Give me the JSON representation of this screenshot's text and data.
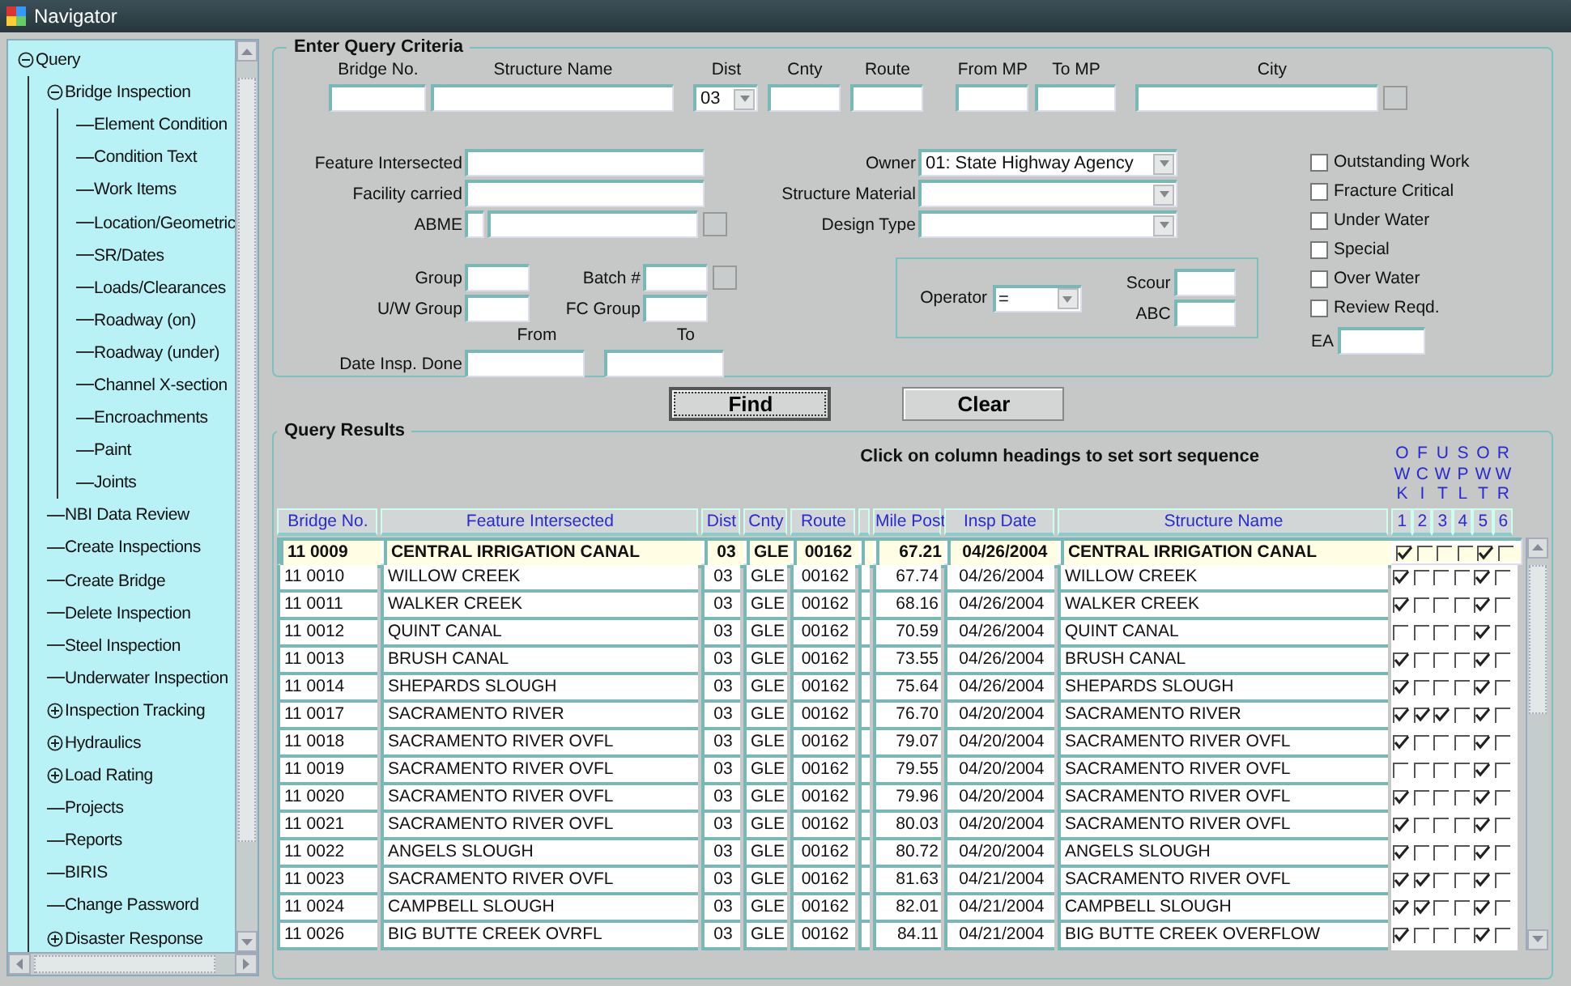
{
  "nav": {
    "title": "Navigator",
    "tree": [
      {
        "label": "Query",
        "expanded": true,
        "children": [
          {
            "label": "Bridge Inspection",
            "expanded": true,
            "children": [
              {
                "label": "Element Condition"
              },
              {
                "label": "Condition Text"
              },
              {
                "label": "Work Items"
              },
              {
                "label": "Location/Geometric"
              },
              {
                "label": "SR/Dates"
              },
              {
                "label": "Loads/Clearances"
              },
              {
                "label": "Roadway (on)"
              },
              {
                "label": "Roadway (under)"
              },
              {
                "label": "Channel X-section"
              },
              {
                "label": "Encroachments"
              },
              {
                "label": "Paint"
              },
              {
                "label": "Joints"
              }
            ]
          },
          {
            "label": "NBI Data Review"
          },
          {
            "label": "Create Inspections"
          },
          {
            "label": "Create Bridge"
          },
          {
            "label": "Delete Inspection"
          },
          {
            "label": "Steel Inspection"
          },
          {
            "label": "Underwater Inspection"
          },
          {
            "label": "Inspection Tracking",
            "expanded": false
          },
          {
            "label": "Hydraulics",
            "expanded": false
          },
          {
            "label": "Load Rating",
            "expanded": false
          },
          {
            "label": "Projects"
          },
          {
            "label": "Reports"
          },
          {
            "label": "BIRIS"
          },
          {
            "label": "Change Password"
          },
          {
            "label": "Disaster Response",
            "expanded": false
          }
        ]
      }
    ]
  },
  "criteria": {
    "title": "Enter Query Criteria",
    "top_fields": [
      {
        "label": "Bridge No.",
        "kind": "text"
      },
      {
        "label": "Structure Name",
        "kind": "text"
      },
      {
        "label": "Dist",
        "kind": "select",
        "value": "03"
      },
      {
        "label": "Cnty",
        "kind": "text"
      },
      {
        "label": "Route",
        "kind": "text"
      },
      {
        "label": "From MP",
        "kind": "text"
      },
      {
        "label": "To MP",
        "kind": "text"
      },
      {
        "label": "City",
        "kind": "lookup"
      }
    ],
    "left_fields": [
      {
        "label": "Feature Intersected",
        "kind": "text"
      },
      {
        "label": "Facility carried",
        "kind": "text"
      },
      {
        "label": "ABME",
        "kind": "code-lookup"
      }
    ],
    "group_fields": [
      {
        "label": "Group",
        "kind": "text"
      },
      {
        "label": "Batch #",
        "kind": "lookup"
      },
      {
        "label": "U/W Group",
        "kind": "text"
      },
      {
        "label": "FC Group",
        "kind": "text"
      }
    ],
    "date_range": {
      "label": "Date Insp. Done",
      "from": "From",
      "to": "To"
    },
    "selects": [
      {
        "label": "Owner",
        "value": "01: State Highway Agency"
      },
      {
        "label": "Structure Material"
      },
      {
        "label": "Design Type"
      }
    ],
    "operator": {
      "label": "Operator",
      "value": "="
    },
    "operator_fields": [
      {
        "label": "Scour"
      },
      {
        "label": "ABC"
      }
    ],
    "flags": [
      {
        "label": "Outstanding Work",
        "checked": false
      },
      {
        "label": "Fracture Critical",
        "checked": false
      },
      {
        "label": "Under Water",
        "checked": false
      },
      {
        "label": "Special",
        "checked": false
      },
      {
        "label": "Over Water",
        "checked": false
      },
      {
        "label": "Review Reqd.",
        "checked": false
      }
    ],
    "ea": {
      "label": "EA"
    }
  },
  "buttons": [
    {
      "label": "Find",
      "focused": true
    },
    {
      "label": "Clear",
      "focused": false
    }
  ],
  "results": {
    "title": "Query Results",
    "hint": "Click on column headings to set sort sequence",
    "columns": [
      "Bridge No.",
      "Feature Intersected",
      "Dist",
      "Cnty",
      "Route",
      "Mile Post",
      "Insp Date",
      "Structure Name"
    ],
    "flag_columns": [
      {
        "letters": [
          "O",
          "W",
          "K"
        ],
        "number": "1"
      },
      {
        "letters": [
          "F",
          "C",
          "I"
        ],
        "number": "2"
      },
      {
        "letters": [
          "U",
          "W",
          "T"
        ],
        "number": "3"
      },
      {
        "letters": [
          "S",
          "P",
          "L"
        ],
        "number": "4"
      },
      {
        "letters": [
          "O",
          "W",
          "T"
        ],
        "number": "5"
      },
      {
        "letters": [
          "R",
          "W",
          "R"
        ],
        "number": "6"
      }
    ],
    "rows": [
      {
        "selected": true,
        "cells": [
          "11 0009",
          "CENTRAL IRRIGATION CANAL",
          "03",
          "GLE",
          "00162",
          "67.21",
          "04/26/2004",
          "CENTRAL IRRIGATION CANAL"
        ],
        "flags": [
          true,
          false,
          false,
          false,
          true,
          false
        ]
      },
      {
        "selected": false,
        "cells": [
          "11 0010",
          "WILLOW CREEK",
          "03",
          "GLE",
          "00162",
          "67.74",
          "04/26/2004",
          "WILLOW CREEK"
        ],
        "flags": [
          true,
          false,
          false,
          false,
          true,
          false
        ]
      },
      {
        "selected": false,
        "cells": [
          "11 0011",
          "WALKER CREEK",
          "03",
          "GLE",
          "00162",
          "68.16",
          "04/26/2004",
          "WALKER CREEK"
        ],
        "flags": [
          true,
          false,
          false,
          false,
          true,
          false
        ]
      },
      {
        "selected": false,
        "cells": [
          "11 0012",
          "QUINT CANAL",
          "03",
          "GLE",
          "00162",
          "70.59",
          "04/26/2004",
          "QUINT CANAL"
        ],
        "flags": [
          false,
          false,
          false,
          false,
          true,
          false
        ]
      },
      {
        "selected": false,
        "cells": [
          "11 0013",
          "BRUSH CANAL",
          "03",
          "GLE",
          "00162",
          "73.55",
          "04/26/2004",
          "BRUSH CANAL"
        ],
        "flags": [
          true,
          false,
          false,
          false,
          true,
          false
        ]
      },
      {
        "selected": false,
        "cells": [
          "11 0014",
          "SHEPARDS SLOUGH",
          "03",
          "GLE",
          "00162",
          "75.64",
          "04/26/2004",
          "SHEPARDS SLOUGH"
        ],
        "flags": [
          true,
          false,
          false,
          false,
          true,
          false
        ]
      },
      {
        "selected": false,
        "cells": [
          "11 0017",
          "SACRAMENTO RIVER",
          "03",
          "GLE",
          "00162",
          "76.70",
          "04/20/2004",
          "SACRAMENTO RIVER"
        ],
        "flags": [
          true,
          true,
          true,
          false,
          true,
          false
        ]
      },
      {
        "selected": false,
        "cells": [
          "11 0018",
          "SACRAMENTO RIVER OVFL",
          "03",
          "GLE",
          "00162",
          "79.07",
          "04/20/2004",
          "SACRAMENTO RIVER OVFL"
        ],
        "flags": [
          true,
          false,
          false,
          false,
          true,
          false
        ]
      },
      {
        "selected": false,
        "cells": [
          "11 0019",
          "SACRAMENTO RIVER OVFL",
          "03",
          "GLE",
          "00162",
          "79.55",
          "04/20/2004",
          "SACRAMENTO RIVER OVFL"
        ],
        "flags": [
          false,
          false,
          false,
          false,
          true,
          false
        ]
      },
      {
        "selected": false,
        "cells": [
          "11 0020",
          "SACRAMENTO RIVER OVFL",
          "03",
          "GLE",
          "00162",
          "79.96",
          "04/20/2004",
          "SACRAMENTO RIVER OVFL"
        ],
        "flags": [
          true,
          false,
          false,
          false,
          true,
          false
        ]
      },
      {
        "selected": false,
        "cells": [
          "11 0021",
          "SACRAMENTO RIVER OVFL",
          "03",
          "GLE",
          "00162",
          "80.03",
          "04/20/2004",
          "SACRAMENTO RIVER OVFL"
        ],
        "flags": [
          true,
          false,
          false,
          false,
          true,
          false
        ]
      },
      {
        "selected": false,
        "cells": [
          "11 0022",
          "ANGELS SLOUGH",
          "03",
          "GLE",
          "00162",
          "80.72",
          "04/20/2004",
          "ANGELS SLOUGH"
        ],
        "flags": [
          true,
          false,
          false,
          false,
          true,
          false
        ]
      },
      {
        "selected": false,
        "cells": [
          "11 0023",
          "SACRAMENTO RIVER OVFL",
          "03",
          "GLE",
          "00162",
          "81.63",
          "04/21/2004",
          "SACRAMENTO RIVER OVFL"
        ],
        "flags": [
          true,
          true,
          false,
          false,
          true,
          false
        ]
      },
      {
        "selected": false,
        "cells": [
          "11 0024",
          "CAMPBELL SLOUGH",
          "03",
          "GLE",
          "00162",
          "82.01",
          "04/21/2004",
          "CAMPBELL SLOUGH"
        ],
        "flags": [
          true,
          true,
          false,
          false,
          true,
          false
        ]
      },
      {
        "selected": false,
        "cells": [
          "11 0026",
          "BIG BUTTE CREEK OVRFL",
          "03",
          "GLE",
          "00162",
          "84.11",
          "04/21/2004",
          "BIG BUTTE CREEK OVERFLOW"
        ],
        "flags": [
          true,
          false,
          false,
          false,
          true,
          false
        ]
      }
    ]
  }
}
